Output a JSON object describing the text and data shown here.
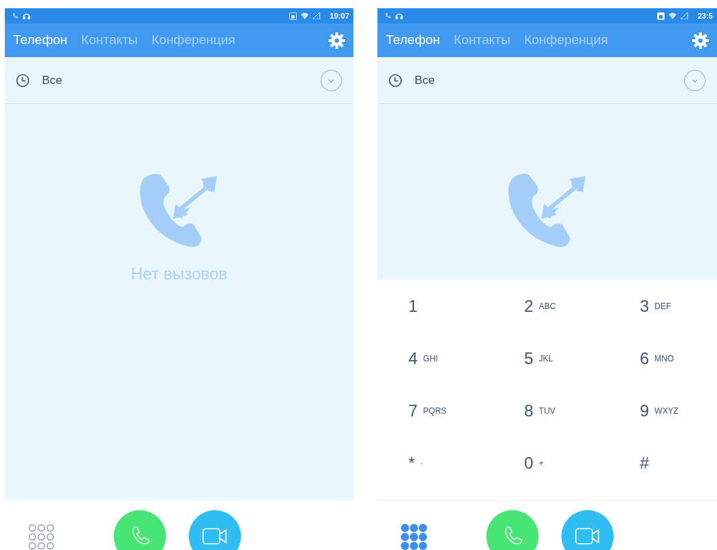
{
  "phones": [
    {
      "status_bar": {
        "time": "19:07"
      },
      "tabs": [
        {
          "label": "Телефон",
          "selected": true
        },
        {
          "label": "Контакты",
          "selected": false
        },
        {
          "label": "Конференция",
          "selected": false
        }
      ],
      "filter": {
        "label": "Все"
      },
      "empty_state": {
        "text": "Нет вызовов"
      },
      "dialpad_open": false
    },
    {
      "status_bar": {
        "time": "23:5"
      },
      "tabs": [
        {
          "label": "Телефон",
          "selected": true
        },
        {
          "label": "Контакты",
          "selected": false
        },
        {
          "label": "Конференция",
          "selected": false
        }
      ],
      "filter": {
        "label": "Все"
      },
      "dialpad_open": true,
      "keys": [
        {
          "digit": "1"
        },
        {
          "digit": "2",
          "letters": "ABC"
        },
        {
          "digit": "3",
          "letters": "DEF"
        },
        {
          "digit": "4",
          "letters": "GHI"
        },
        {
          "digit": "5",
          "letters": "JKL"
        },
        {
          "digit": "6",
          "letters": "MNO"
        },
        {
          "digit": "7",
          "letters": "PQRS"
        },
        {
          "digit": "8",
          "letters": "TUV"
        },
        {
          "digit": "9",
          "letters": "WXYZ"
        },
        {
          "digit": "*",
          "letters": "·"
        },
        {
          "digit": "0",
          "letters": "+"
        },
        {
          "digit": "#"
        }
      ]
    }
  ]
}
